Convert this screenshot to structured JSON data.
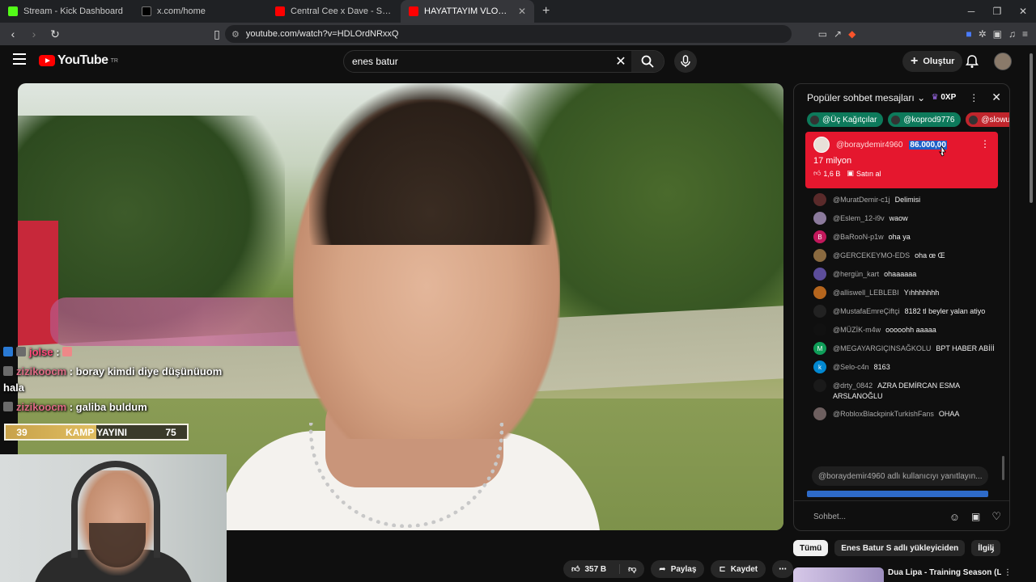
{
  "browser": {
    "tabs": [
      {
        "title": "Stream - Kick Dashboard",
        "color": "#53fc18"
      },
      {
        "title": "x.com/home",
        "color": "#000000"
      },
      {
        "title": "Central Cee x Dave - Sprinter [Music",
        "color": "#ff0000"
      },
      {
        "title": "HAYATTAYIM VLOG - YouTube",
        "color": "#ff0000"
      }
    ],
    "url": "youtube.com/watch?v=HDLOrdNRxxQ"
  },
  "youtube": {
    "logo_text": "YouTube",
    "logo_sup": "TR",
    "search_value": "enes batur",
    "create_label": "Oluştur"
  },
  "overlay_chat": {
    "line1_user": "jolse",
    "line1_sep": " : ",
    "line2_user": "zizikoocm",
    "line2_text": " : boray kimdi diye düşünüuom hala",
    "line3_user": "zizikoocm",
    "line3_text": " : galiba buldum",
    "bar_left": "39",
    "bar_title": "KAMP YAYINI",
    "bar_right": "75"
  },
  "chat": {
    "title": "Popüler sohbet mesajları",
    "xp": "0XP",
    "chips": [
      "@Üç Kağıtçılar",
      "@koprod9776",
      "@slowuee"
    ],
    "superchat": {
      "author": "@boraydemir4960",
      "amount": "86.000,00",
      "message": "17 milyon",
      "likes": "1,6 B",
      "buy": "Satın al"
    },
    "messages": [
      {
        "author": "@MuratDemir-c1j",
        "text": "Delimisi",
        "color": "#5a2a2a"
      },
      {
        "author": "@Eslem_12-i9v",
        "text": "waow",
        "color": "#8b7a9c"
      },
      {
        "author": "@BaRooN-p1w",
        "text": "oha ya",
        "color": "#c2185b",
        "letter": "B"
      },
      {
        "author": "@GERCEKEYMO-EDS",
        "text": "oha œ Œ",
        "color": "#8a6a40"
      },
      {
        "author": "@hergün_kart",
        "text": "ohaaaaaa",
        "color": "#5c4d9a"
      },
      {
        "author": "@alliswell_LEBLEBI",
        "text": "Yıhhhhhhh",
        "color": "#b5651d"
      },
      {
        "author": "@MustafaEmreÇiftçi",
        "text": "8182 tl beyler yalan atiyo",
        "color": "#222222"
      },
      {
        "author": "@MÜZİK-m4w",
        "text": "ooooohh aaaaa",
        "color": "#111111"
      },
      {
        "author": "@MEGAYARGIÇINSAĞKOLU",
        "text": "BPT HABER ABİİİ",
        "color": "#0f9d58",
        "letter": "M"
      },
      {
        "author": "@Selo-c4n",
        "text": "8163",
        "color": "#0288d1",
        "letter": "k"
      },
      {
        "author": "@drty_0842",
        "text": "AZRA DEMİRCAN ESMA ARSLANOĞLU",
        "color": "#1a1a1a"
      },
      {
        "author": "@RobloxBlackpinkTurkishFans",
        "text": "OHAA",
        "color": "#6d5f5f"
      }
    ],
    "reply_placeholder": "@boraydemir4960 adlı kullanıcıyı yanıtlayın...",
    "input_placeholder": "Sohbet..."
  },
  "actions": {
    "likes": "357 B",
    "share": "Paylaş",
    "save": "Kaydet"
  },
  "filters": [
    "Tümü",
    "Enes Batur S adlı yükleyiciden",
    "İlgili"
  ],
  "recommendation": {
    "title": "Dua Lipa - Training Season (Live"
  }
}
